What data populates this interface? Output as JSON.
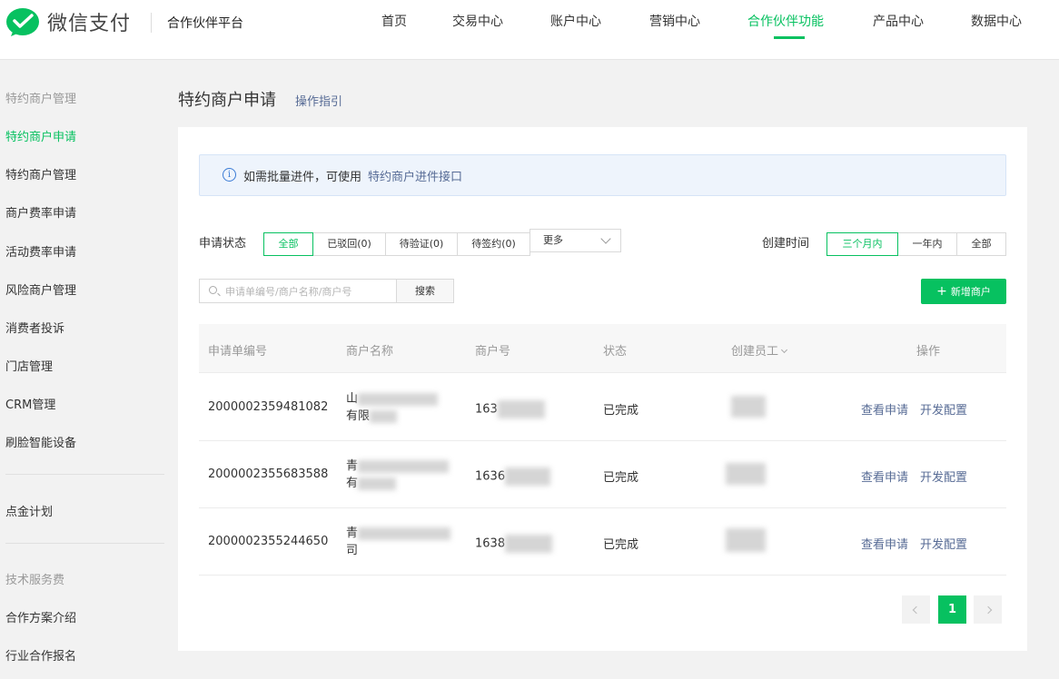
{
  "header": {
    "logo_text": "微信支付",
    "platform": "合作伙伴平台",
    "nav": [
      "首页",
      "交易中心",
      "账户中心",
      "营销中心",
      "合作伙伴功能",
      "产品中心",
      "数据中心"
    ],
    "brand_color": "#07c160"
  },
  "sidebar": {
    "group1": "特约商户管理",
    "items1": [
      "特约商户申请",
      "特约商户管理",
      "商户费率申请",
      "活动费率申请",
      "风险商户管理",
      "消费者投诉",
      "门店管理",
      "CRM管理",
      "刷脸智能设备"
    ],
    "item_plan": "点金计划",
    "group2": "技术服务费",
    "items2": [
      "合作方案介绍",
      "行业合作报名"
    ]
  },
  "page": {
    "title": "特约商户申请",
    "guide": "操作指引"
  },
  "notice": {
    "text": "如需批量进件，可使用",
    "link": "特约商户进件接口"
  },
  "filters": {
    "status_label": "申请状态",
    "status_options": [
      "全部",
      "已驳回(0)",
      "待验证(0)",
      "待签约(0)"
    ],
    "more": "更多",
    "time_label": "创建时间",
    "time_options": [
      "三个月内",
      "一年内",
      "全部"
    ]
  },
  "search": {
    "placeholder": "申请单编号/商户名称/商户号",
    "button": "搜索",
    "add_button": "新增商户"
  },
  "table": {
    "headers": [
      "申请单编号",
      "商户名称",
      "商户号",
      "状态",
      "创建员工",
      "操作"
    ],
    "rows": [
      {
        "id": "2000002359481082",
        "name_line1": "山",
        "name_line2": "有限",
        "merchant_prefix": "163",
        "status": "已完成"
      },
      {
        "id": "2000002355683588",
        "name_line1": "青",
        "name_line2": "有",
        "merchant_prefix": "1636",
        "status": "已完成"
      },
      {
        "id": "2000002355244650",
        "name_line1": "青",
        "name_line2": "司",
        "merchant_prefix": "1638",
        "status": "已完成"
      }
    ],
    "action_view": "查看申请",
    "action_dev": "开发配置"
  },
  "pagination": {
    "current": "1"
  }
}
